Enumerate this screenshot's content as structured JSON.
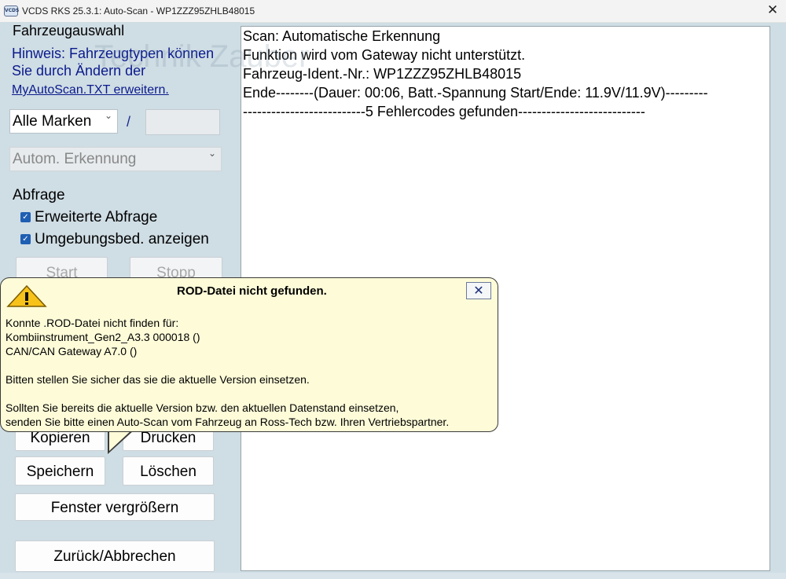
{
  "window": {
    "title": "VCDS RKS 25.3.1:  Auto-Scan  -  WP1ZZZ95ZHLB48015",
    "app_icon_text": "VCDS",
    "close_glyph": "✕"
  },
  "left": {
    "section_title": "Fahrzeugauswahl",
    "hint_line1": "Hinweis: Fahrzeugtypen können",
    "hint_line2": "Sie durch Ändern der",
    "hint_link": "MyAutoScan.TXT erweitern.",
    "brand_select": "Alle Marken",
    "separator": "/",
    "type_select": "Autom. Erkennung",
    "query_title": "Abfrage",
    "checkbox1": "Erweiterte Abfrage",
    "checkbox2": "Umgebungsbed. anzeigen",
    "start_button": "Start",
    "stop_button": "Stopp",
    "copy_button": "Kopieren",
    "print_button": "Drucken",
    "save_button": "Speichern",
    "delete_button": "Löschen",
    "enlarge_button": "Fenster vergrößern",
    "back_button": "Zurück/Abbrechen"
  },
  "output": {
    "watermark": "Technik Zauber",
    "lines": [
      "Scan: Automatische Erkennung",
      "Funktion wird vom Gateway nicht unterstützt.",
      "Fahrzeug-Ident.-Nr.: WP1ZZZ95ZHLB48015",
      "Ende--------(Dauer: 00:06, Batt.-Spannung Start/Ende: 11.9V/11.9V)---------",
      "--------------------------5 Fehlercodes gefunden---------------------------"
    ]
  },
  "tooltip": {
    "title": "ROD-Datei nicht gefunden.",
    "close_glyph": "✕",
    "lines": [
      "Konnte .ROD-Datei nicht finden für:",
      "Kombiinstrument_Gen2_A3.3 000018 ()",
      "CAN/CAN Gateway A7.0   ()",
      "",
      "Bitten stellen Sie sicher das sie die aktuelle Version einsetzen.",
      "",
      "Sollten Sie bereits die aktuelle Version bzw. den aktuellen Datenstand einsetzen,",
      "senden Sie bitte einen Auto-Scan vom Fahrzeug an Ross-Tech bzw. Ihren Vertriebspartner."
    ]
  }
}
